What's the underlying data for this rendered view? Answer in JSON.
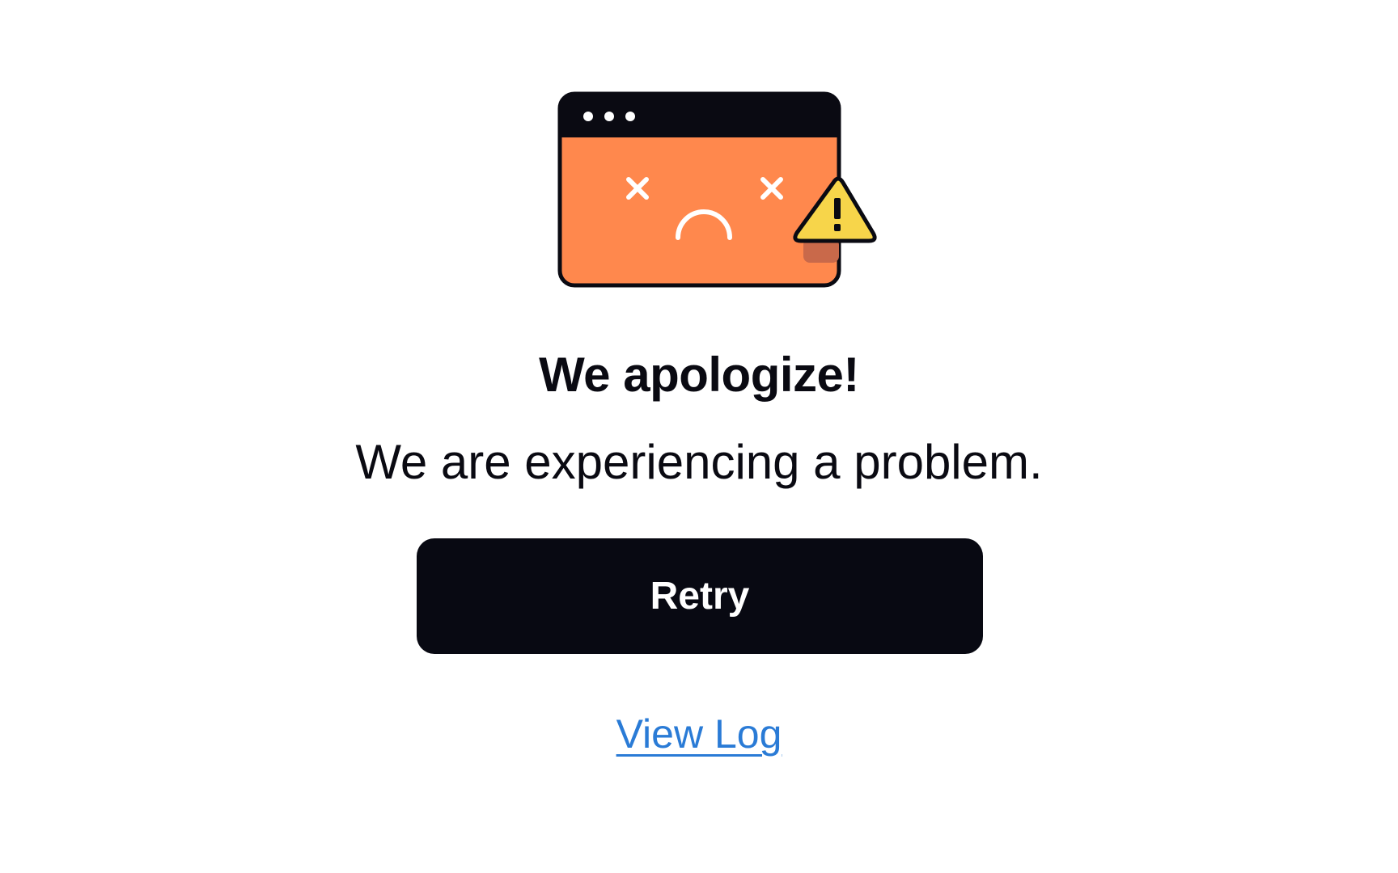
{
  "illustration": {
    "name": "broken-browser-window-illustration",
    "colors": {
      "window_body": "#ff884d",
      "window_frame": "#0a0a12",
      "face": "#ffffff",
      "warning_fill": "#f7d54a",
      "warning_shadow": "#c9694a"
    }
  },
  "error": {
    "title": "We apologize!",
    "message": "We are experiencing a problem."
  },
  "actions": {
    "retry_label": "Retry",
    "view_log_label": "View Log"
  },
  "colors": {
    "button_background": "#080912",
    "button_text": "#ffffff",
    "link": "#2a7bd6",
    "text": "#0a0a12"
  }
}
